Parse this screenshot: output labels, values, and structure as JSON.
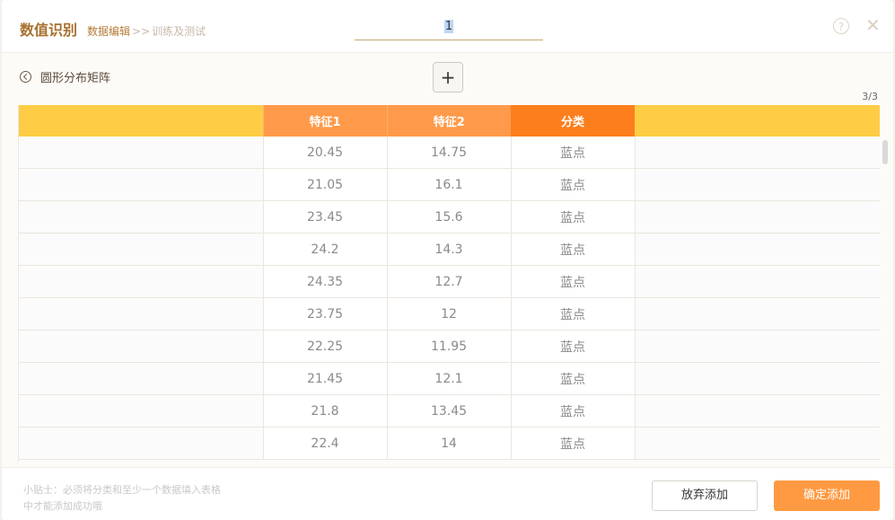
{
  "header": {
    "title": "数值识别",
    "breadcrumb_active": "数据编辑",
    "breadcrumb_sep": ">>",
    "breadcrumb_next": "训练及测试",
    "name_value": "1"
  },
  "toolbar": {
    "back_label": "圆形分布矩阵",
    "add_symbol": "+",
    "page_indicator": "3/3"
  },
  "table": {
    "columns": [
      "",
      "特征1",
      "特征2",
      "分类",
      ""
    ],
    "rows": [
      {
        "f1": "20.45",
        "f2": "14.75",
        "cls": "蓝点"
      },
      {
        "f1": "21.05",
        "f2": "16.1",
        "cls": "蓝点"
      },
      {
        "f1": "23.45",
        "f2": "15.6",
        "cls": "蓝点"
      },
      {
        "f1": "24.2",
        "f2": "14.3",
        "cls": "蓝点"
      },
      {
        "f1": "24.35",
        "f2": "12.7",
        "cls": "蓝点"
      },
      {
        "f1": "23.75",
        "f2": "12",
        "cls": "蓝点"
      },
      {
        "f1": "22.25",
        "f2": "11.95",
        "cls": "蓝点"
      },
      {
        "f1": "21.45",
        "f2": "12.1",
        "cls": "蓝点"
      },
      {
        "f1": "21.8",
        "f2": "13.45",
        "cls": "蓝点"
      },
      {
        "f1": "22.4",
        "f2": "14",
        "cls": "蓝点"
      }
    ]
  },
  "footer": {
    "tip_line1": "小贴士：必须将分类和至少一个数据填入表格",
    "tip_line2": "中才能添加成功哦",
    "cancel_label": "放弃添加",
    "confirm_label": "确定添加"
  },
  "icons": {
    "help": "help-icon",
    "close": "close-icon",
    "back": "back-arrow-icon"
  },
  "colors": {
    "header_yellow": "#ffcd45",
    "feature_orange": "#ff9a4a",
    "class_orange": "#fd7e1d",
    "confirm_orange": "#ff9a42"
  }
}
